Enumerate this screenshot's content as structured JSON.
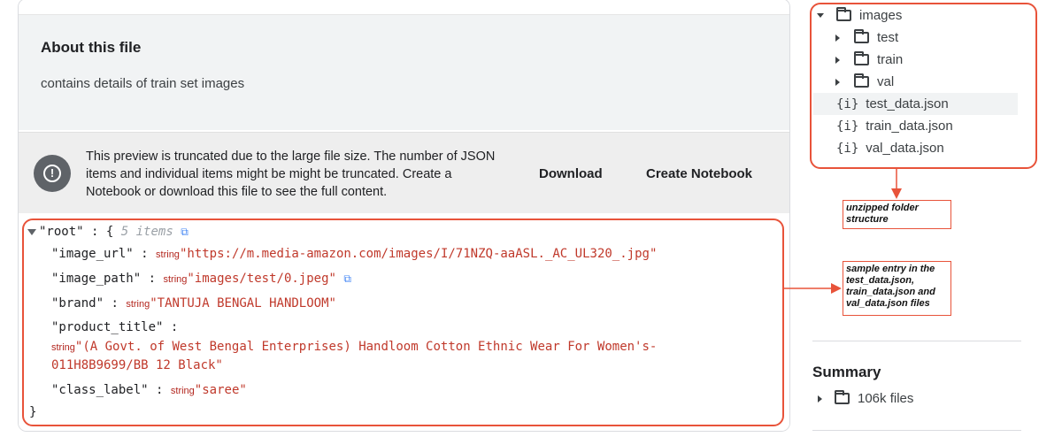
{
  "about": {
    "heading": "About this file",
    "description": "contains details of train set images"
  },
  "notice": {
    "icon": "warning-icon",
    "text": "This preview is truncated due to the large file size. The number of JSON items and individual items might be might be truncated. Create a Notebook or download this file to see the full content.",
    "download_label": "Download",
    "notebook_label": "Create Notebook"
  },
  "json_preview": {
    "root_key": "\"root\"",
    "root_open": "{",
    "root_count": "5 items",
    "root_close": "}",
    "type_string": "string",
    "colon": ":",
    "fields": [
      {
        "key": "\"image_url\"",
        "value": "\"https://m.media-amazon.com/images/I/71NZQ-aaASL._AC_UL320_.jpg\""
      },
      {
        "key": "\"image_path\"",
        "value": "\"images/test/0.jpeg\""
      },
      {
        "key": "\"brand\"",
        "value": "\"TANTUJA BENGAL HANDLOOM\""
      },
      {
        "key": "\"product_title\"",
        "value_line1": "\"(A Govt. of West Bengal Enterprises) Handloom Cotton Ethnic Wear For Women's-",
        "value_line2": "011H8B9699/BB 12 Black\""
      },
      {
        "key": "\"class_label\"",
        "value": "\"saree\""
      }
    ]
  },
  "tree": {
    "items": [
      {
        "label": "images",
        "kind": "folder",
        "expanded": true
      },
      {
        "label": "test",
        "kind": "folder",
        "expanded": false
      },
      {
        "label": "train",
        "kind": "folder",
        "expanded": false
      },
      {
        "label": "val",
        "kind": "folder",
        "expanded": false
      },
      {
        "label": "test_data.json",
        "kind": "json",
        "selected": true
      },
      {
        "label": "train_data.json",
        "kind": "json"
      },
      {
        "label": "val_data.json",
        "kind": "json"
      }
    ],
    "json_icon": "{i}"
  },
  "annotations": {
    "folder_note": "unzipped folder structure",
    "sample_note": "sample entry in the test_data.json, train_data.json and val_data.json files"
  },
  "summary": {
    "heading": "Summary",
    "files_label": "106k files"
  },
  "colors": {
    "annotation_red": "#e8533a",
    "string_value": "#c0392b",
    "panel_gray": "#f1f3f4"
  }
}
